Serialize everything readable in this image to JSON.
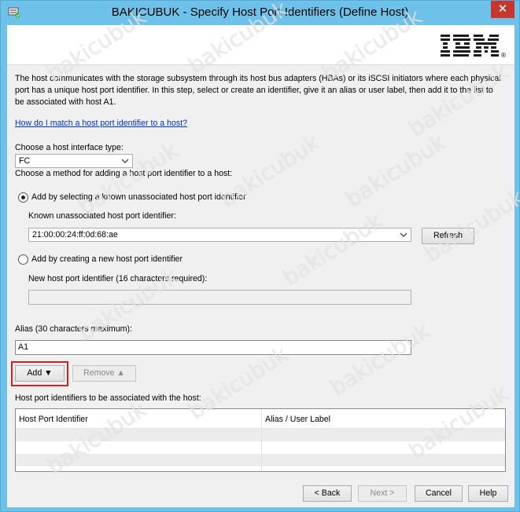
{
  "window": {
    "title": "BAKICUBUK - Specify Host Port Identifiers (Define Host)",
    "close_label": "✕"
  },
  "brand": {
    "logo_text": "IBM",
    "registered_mark": "®"
  },
  "description": "The host communicates with the storage subsystem through its host bus adapters (HBAs) or its iSCSI initiators where each physical port has a unique host port identifier. In this step, select or create an identifier, give it an alias or user label, then add it to the list to be associated with host A1.",
  "help_link": "How do I match a host port identifier to a host?",
  "interface": {
    "label": "Choose a host interface type:",
    "selected": "FC"
  },
  "method_label": "Choose a method for adding a host port identifier to a host:",
  "known": {
    "radio_label": "Add by selecting a known unassociated host port identifier",
    "field_label": "Known unassociated host port identifier:",
    "selected": "21:00:00:24:ff:0d:68:ae",
    "refresh_label": "Refresh"
  },
  "new_id": {
    "radio_label": "Add by creating a new host port identifier",
    "field_label": "New host port identifier (16 characters required):",
    "value": ""
  },
  "alias": {
    "label": "Alias (30 characters maximum):",
    "value": "A1"
  },
  "actions": {
    "add_label": "Add ▼",
    "remove_label": "Remove ▲"
  },
  "table": {
    "label": "Host port identifiers to be associated with the host:",
    "columns": [
      "Host Port Identifier",
      "Alias / User Label"
    ],
    "rows": []
  },
  "footer": {
    "back_label": "< Back",
    "next_label": "Next >",
    "cancel_label": "Cancel",
    "help_label": "Help"
  },
  "watermark_text": "bakicubuk",
  "colors": {
    "titlebar": "#6ec1e8",
    "close": "#c7372f",
    "link": "#0033cc",
    "highlight": "#d42020"
  }
}
